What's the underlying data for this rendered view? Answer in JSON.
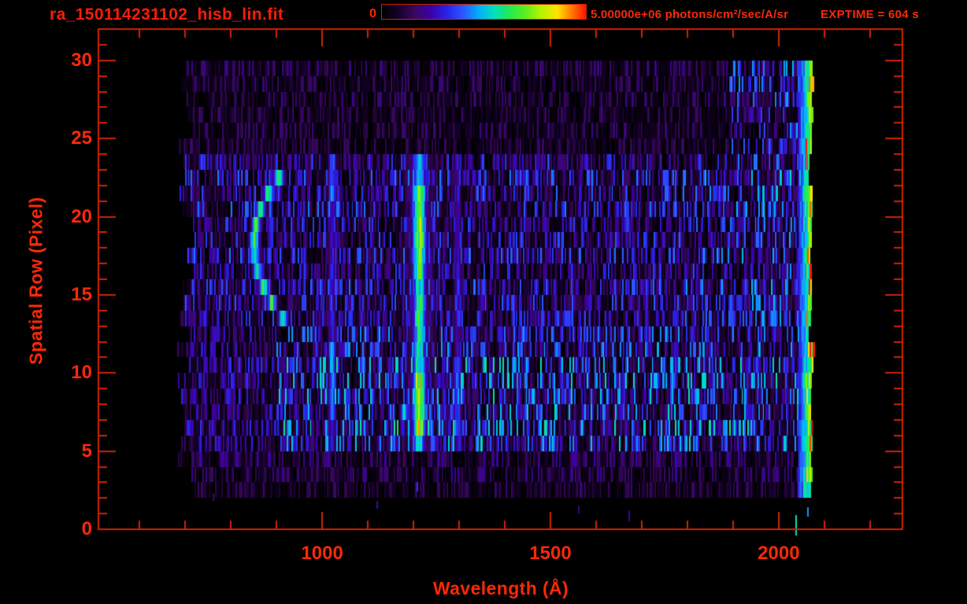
{
  "window": {
    "background": "#000000"
  },
  "colors": {
    "label_text": "#fb2808",
    "title_text": "#f81d06",
    "axis_frame": "#cf2203",
    "plot_background": "#000000"
  },
  "header": {
    "title": "ra_150114231102_hisb_lin.fit",
    "colorbar_min_label": "0",
    "colorbar_max_label": "5.00000e+06 photons/cm²/sec/A/sr",
    "exptime_label": "EXPTIME = 604 s"
  },
  "chart_data": {
    "type": "heatmap",
    "title": "ra_150114231102_hisb_lin.fit",
    "xlabel": "Wavelength (Å)",
    "ylabel": "Spatial Row (Pixel)",
    "x_range_angstrom": [
      510,
      2271
    ],
    "y_range_rows": [
      0,
      32
    ],
    "x_major_ticks": [
      1000,
      1500,
      2000
    ],
    "x_minor_tick_step": 100,
    "y_major_ticks": [
      0,
      5,
      10,
      15,
      20,
      25,
      30
    ],
    "y_minor_tick_step": 1,
    "colorbar": {
      "min": 0,
      "max": 5000000,
      "units": "photons/cm²/sec/A/sr"
    },
    "exptime_seconds": 604,
    "colormap_stops": [
      [
        0.0,
        "#000000"
      ],
      [
        0.08,
        "#16002a"
      ],
      [
        0.16,
        "#38085e"
      ],
      [
        0.24,
        "#3c00a8"
      ],
      [
        0.32,
        "#2824e8"
      ],
      [
        0.4,
        "#2a58ff"
      ],
      [
        0.48,
        "#00b4f8"
      ],
      [
        0.55,
        "#00e0c0"
      ],
      [
        0.62,
        "#20e858"
      ],
      [
        0.7,
        "#58ee20"
      ],
      [
        0.78,
        "#b4f400"
      ],
      [
        0.86,
        "#ffe400"
      ],
      [
        0.93,
        "#ff7a00"
      ],
      [
        1.0,
        "#ff1400"
      ]
    ],
    "data_extent": {
      "wavelength": [
        683,
        2070
      ],
      "rows": [
        2,
        30
      ]
    },
    "noise_bands": [
      {
        "rows": [
          2,
          3
        ],
        "amp": 0.1
      },
      {
        "rows": [
          3,
          5
        ],
        "amp": 0.13
      },
      {
        "rows": [
          5,
          13
        ],
        "amp": 0.3,
        "dim_below_lambda": 900,
        "dim_factor": 0.6
      },
      {
        "rows": [
          13,
          24
        ],
        "amp": 0.22,
        "ramp_above_lambda": 1700,
        "ramp_amp": 0.1
      },
      {
        "rows": [
          24,
          30
        ],
        "amp": 0.11,
        "bright_above_lambda": 1890,
        "bright_amp": 0.26
      }
    ],
    "features": [
      {
        "name": "calibration-arc",
        "type": "arc",
        "lambda0": 849,
        "row_center": 18.2,
        "curve": 2.9,
        "sigma": 8,
        "rows": [
          13.4,
          23.5
        ],
        "amp": 0.62
      },
      {
        "name": "emission-line-1020",
        "type": "line",
        "lambda0": 1020,
        "sigma": 6.5,
        "rows": [
          4.8,
          24.2
        ],
        "amp": 0.3,
        "boosts": [
          {
            "rows": [
              6.8,
              12.4
            ],
            "amp": 0.46
          },
          {
            "rows": [
              20.6,
              23.8
            ],
            "amp": 0.42
          }
        ]
      },
      {
        "name": "lyman-alpha-line",
        "type": "line",
        "lambda0": 1211,
        "sigma": 11,
        "rows": [
          4.9,
          24.2
        ],
        "amp": 0.55,
        "halo_sigma": 26,
        "halo_amp": 0.22,
        "boosts": [
          {
            "rows": [
              5.6,
              9.8
            ],
            "amp": 0.8
          },
          {
            "rows": [
              16.2,
              22.4
            ],
            "amp": 0.74
          },
          {
            "rows": [
              9.8,
              15.2
            ],
            "amp": 0.6
          }
        ]
      },
      {
        "name": "emission-line-1295",
        "type": "line",
        "lambda0": 1295,
        "sigma": 6.5,
        "rows": [
          4.9,
          24.2
        ],
        "amp": 0.26,
        "boosts": [
          {
            "rows": [
              6.2,
              10.8
            ],
            "amp": 0.4
          }
        ]
      },
      {
        "name": "long-wavelength-bright-edge",
        "type": "edge",
        "range": [
          2040,
          2072
        ],
        "rows": [
          1.8,
          30
        ],
        "amp_base": 0.28,
        "amp_peak": 0.78,
        "red_chance": 0.25,
        "red_min_lambda": 2058
      }
    ],
    "specks": [
      {
        "lambda": 1207,
        "row": 2.4,
        "span": 0.6,
        "v": 0.35
      },
      {
        "lambda": 1671,
        "row": 0.5,
        "span": 0.7,
        "v": 0.22
      },
      {
        "lambda": 2036,
        "row": -0.4,
        "span": 1.3,
        "v": 0.55
      },
      {
        "lambda": 2062,
        "row": 0.8,
        "span": 0.6,
        "v": 0.45
      },
      {
        "lambda": 1118,
        "row": 1.3,
        "span": 0.5,
        "v": 0.26
      },
      {
        "lambda": 1560,
        "row": 1.0,
        "span": 0.5,
        "v": 0.2
      },
      {
        "lambda": 760,
        "row": 1.8,
        "span": 0.5,
        "v": 0.18
      }
    ]
  }
}
